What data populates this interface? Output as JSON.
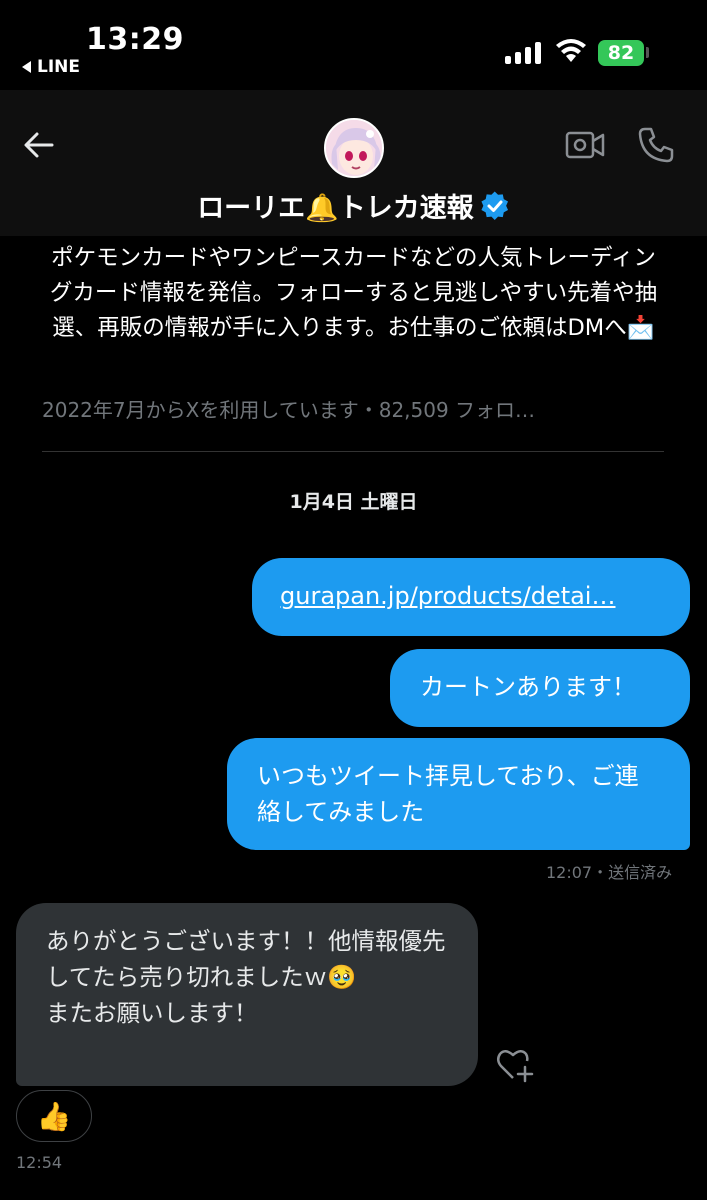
{
  "status_bar": {
    "time": "13:29",
    "back_app": "LINE",
    "battery": "82"
  },
  "header": {
    "name": "ローリエ🔔トレカ速報"
  },
  "bio": {
    "text": "ポケモンカードやワンピースカードなどの人気トレーディングカード情報を発信。フォローすると見逃しやすい先着や抽選、再販の情報が手に入ります。お仕事のご依頼はDMへ📩",
    "meta": "2022年7月からXを利用しています・82,509 フォロ…"
  },
  "date_separator": "1月4日 土曜日",
  "messages": [
    {
      "text": "gurapan.jp/products/detai…",
      "is_link": true
    },
    {
      "text": "カートンあります！"
    },
    {
      "text": "いつもツイート拝見しており、ご連絡してみました"
    },
    {
      "text": "ありがとうございます！！他情報優先してたら売り切れましたｗ🥹\nまたお願いします！"
    }
  ],
  "outgoing_meta": "12:07・送信済み",
  "reaction_emoji": "👍",
  "incoming_time": "12:54",
  "colors": {
    "accent": "#1d9bf0",
    "incoming_bubble": "#2f3336",
    "battery": "#34c759"
  },
  "icons": [
    "back-arrow-icon",
    "video-icon",
    "phone-icon",
    "verified-badge-icon",
    "add-reaction-icon",
    "wifi-icon",
    "signal-icon"
  ]
}
